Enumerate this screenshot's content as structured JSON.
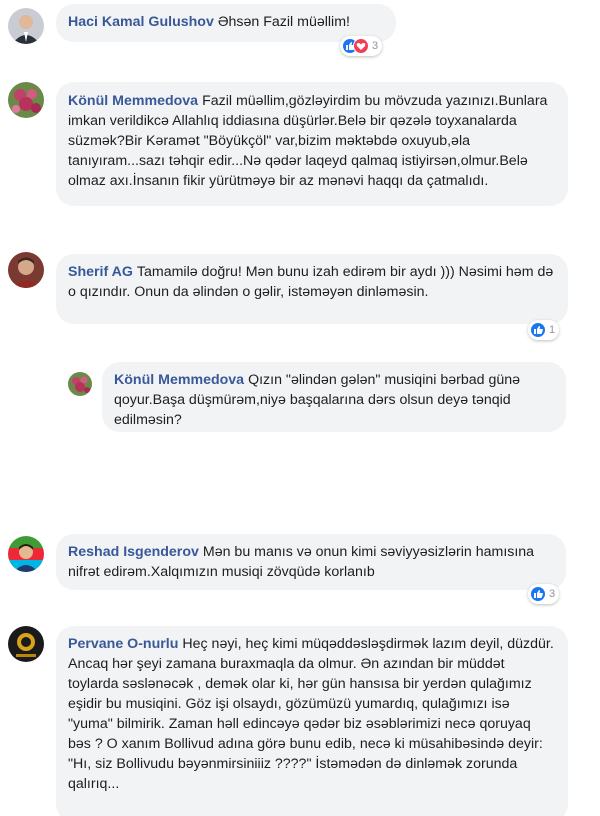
{
  "comments": [
    {
      "author": "Haci Kamal Gulushov",
      "text": "Əhsən Fazil müəllim!",
      "reactions": {
        "types": [
          "like-icon",
          "love-icon"
        ],
        "count": "3"
      }
    },
    {
      "author": "Könül Memmedova",
      "text": "Fazil müəllim,gözləyirdim bu mövzuda yazınızı.Bunlara imkan verildikcə Allahlıq iddiasına düşürlər.Belə bir qəzələ toyxanalarda süzmək?Bir Kəramət \"Böyükçöl\" var,bizim məktəbdə oxuyub,əla tanıyıram...sazı təhqir edir...Nə qədər laqeyd qalmaq istiyirsən,olmur.Belə olmaz axı.İnsanın fikir yürütməyə bir az mənəvi haqqı da çatmalıdı."
    },
    {
      "author": "Sherif AG",
      "text": "Tamamilə doğru! Mən bunu izah edirəm bir aydı ))) Nəsimi həm də o qızındır. Onun da əlindən o gəlir, istəməyən dinləməsin.",
      "reactions": {
        "types": [
          "like-icon"
        ],
        "count": "1"
      }
    },
    {
      "author": "Könül Memmedova",
      "text": "Qızın \"əlindən gələn\" musiqini bərbad günə qoyur.Başa düşmürəm,niyə başqalarına dərs olsun deyə tənqid edilməsin?"
    },
    {
      "author": "Reshad Isgenderov",
      "text": "Mən bu manıs və onun kimi səviyyəsizlərin hamısına nifrət edirəm.Xalqımızın musiqi zövqüdə korlanıb",
      "reactions": {
        "types": [
          "like-icon"
        ],
        "count": "3"
      }
    },
    {
      "author": "Pervane O-nurlu",
      "text": "Heç nəyi, heç kimi müqəddəsləşdirmək lazım deyil, düzdür. Ancaq hər şeyi zamana buraxmaqla da olmur. Ən azından bir müddət toylarda səslənəcək , demək olar ki, hər gün hansısa bir yerdən qulağımız eşidir bu musiqini. Göz işi olsaydı, gözümüzü yumardıq, qulağımızı isə \"yuma\" bilmirik. Zaman həll edincəyə qədər biz əsəblərimizi necə qoruyaq bəs ? O xanım Bollivud adına görə bunu edib, necə ki müsahibəsində deyir: \"Hı, siz Bollivudu bəyənmirsiniiiz ????\" İstəmədən də dinləmək zorunda qalırıq..."
    }
  ],
  "colors": {
    "author": "#385898",
    "bubble": "#f2f3f5",
    "like": "#1877f2",
    "love": "#f33e58"
  }
}
